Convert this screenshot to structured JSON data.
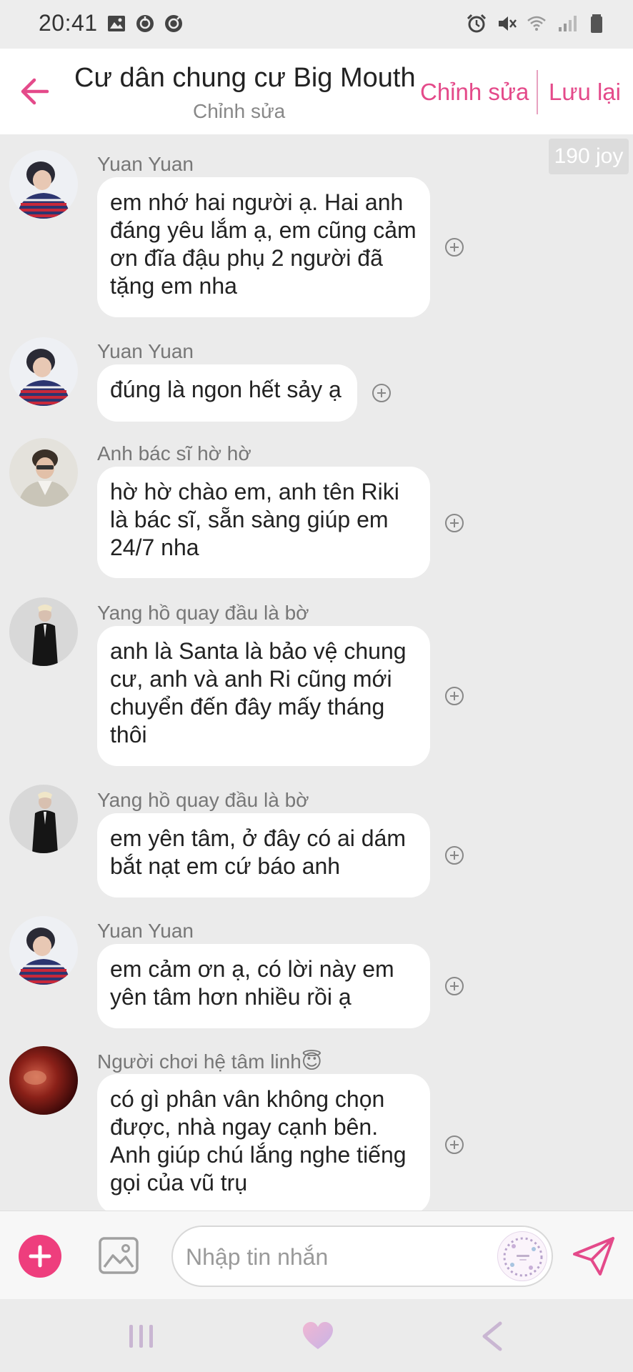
{
  "status_bar": {
    "time": "20:41",
    "left_icons": [
      "gallery-icon",
      "app-icon",
      "app-icon"
    ],
    "right_icons": [
      "alarm-icon",
      "mute-icon",
      "wifi-icon",
      "signal-icon",
      "battery-icon"
    ]
  },
  "header": {
    "title": "Cư dân chung cư Big Mouth",
    "subtitle": "Chỉnh sửa",
    "edit_label": "Chỉnh sửa",
    "save_label": "Lưu lại"
  },
  "joy_badge": "190 joy",
  "messages": [
    {
      "sender": "Yuan Yuan",
      "text": "em nhớ hai người ạ. Hai anh đáng yêu lắm ạ, em cũng cảm ơn đĩa đậu phụ 2 người đã tặng em nha"
    },
    {
      "sender": "Yuan Yuan",
      "text": "đúng là ngon hết sảy ạ"
    },
    {
      "sender": "Anh bác sĩ hờ hờ",
      "text": "hờ hờ chào em, anh tên Riki là bác sĩ, sẵn sàng giúp em 24/7 nha"
    },
    {
      "sender": "Yang hồ quay đầu là bờ",
      "text": "anh là Santa là bảo vệ chung cư, anh và anh Ri cũng mới chuyển đến đây mấy tháng thôi"
    },
    {
      "sender": "Yang hồ quay đầu là bờ",
      "text": "em yên tâm, ở đây có ai dám bắt nạt em cứ báo anh"
    },
    {
      "sender": "Yuan Yuan",
      "text": "em cảm ơn ạ, có lời này em yên tâm hơn nhiều rồi ạ"
    },
    {
      "sender": "Người chơi hệ tâm linh😇",
      "text": "có gì phân vân không chọn được, nhà ngay cạnh bên. Anh giúp chú lắng nghe tiếng gọi của vũ trụ"
    }
  ],
  "composer": {
    "placeholder": "Nhập tin nhắn",
    "value": ""
  },
  "colors": {
    "accent": "#e44a8a",
    "add_button": "#ee3e7d",
    "chat_background": "#ebebeb",
    "bubble": "#ffffff"
  }
}
